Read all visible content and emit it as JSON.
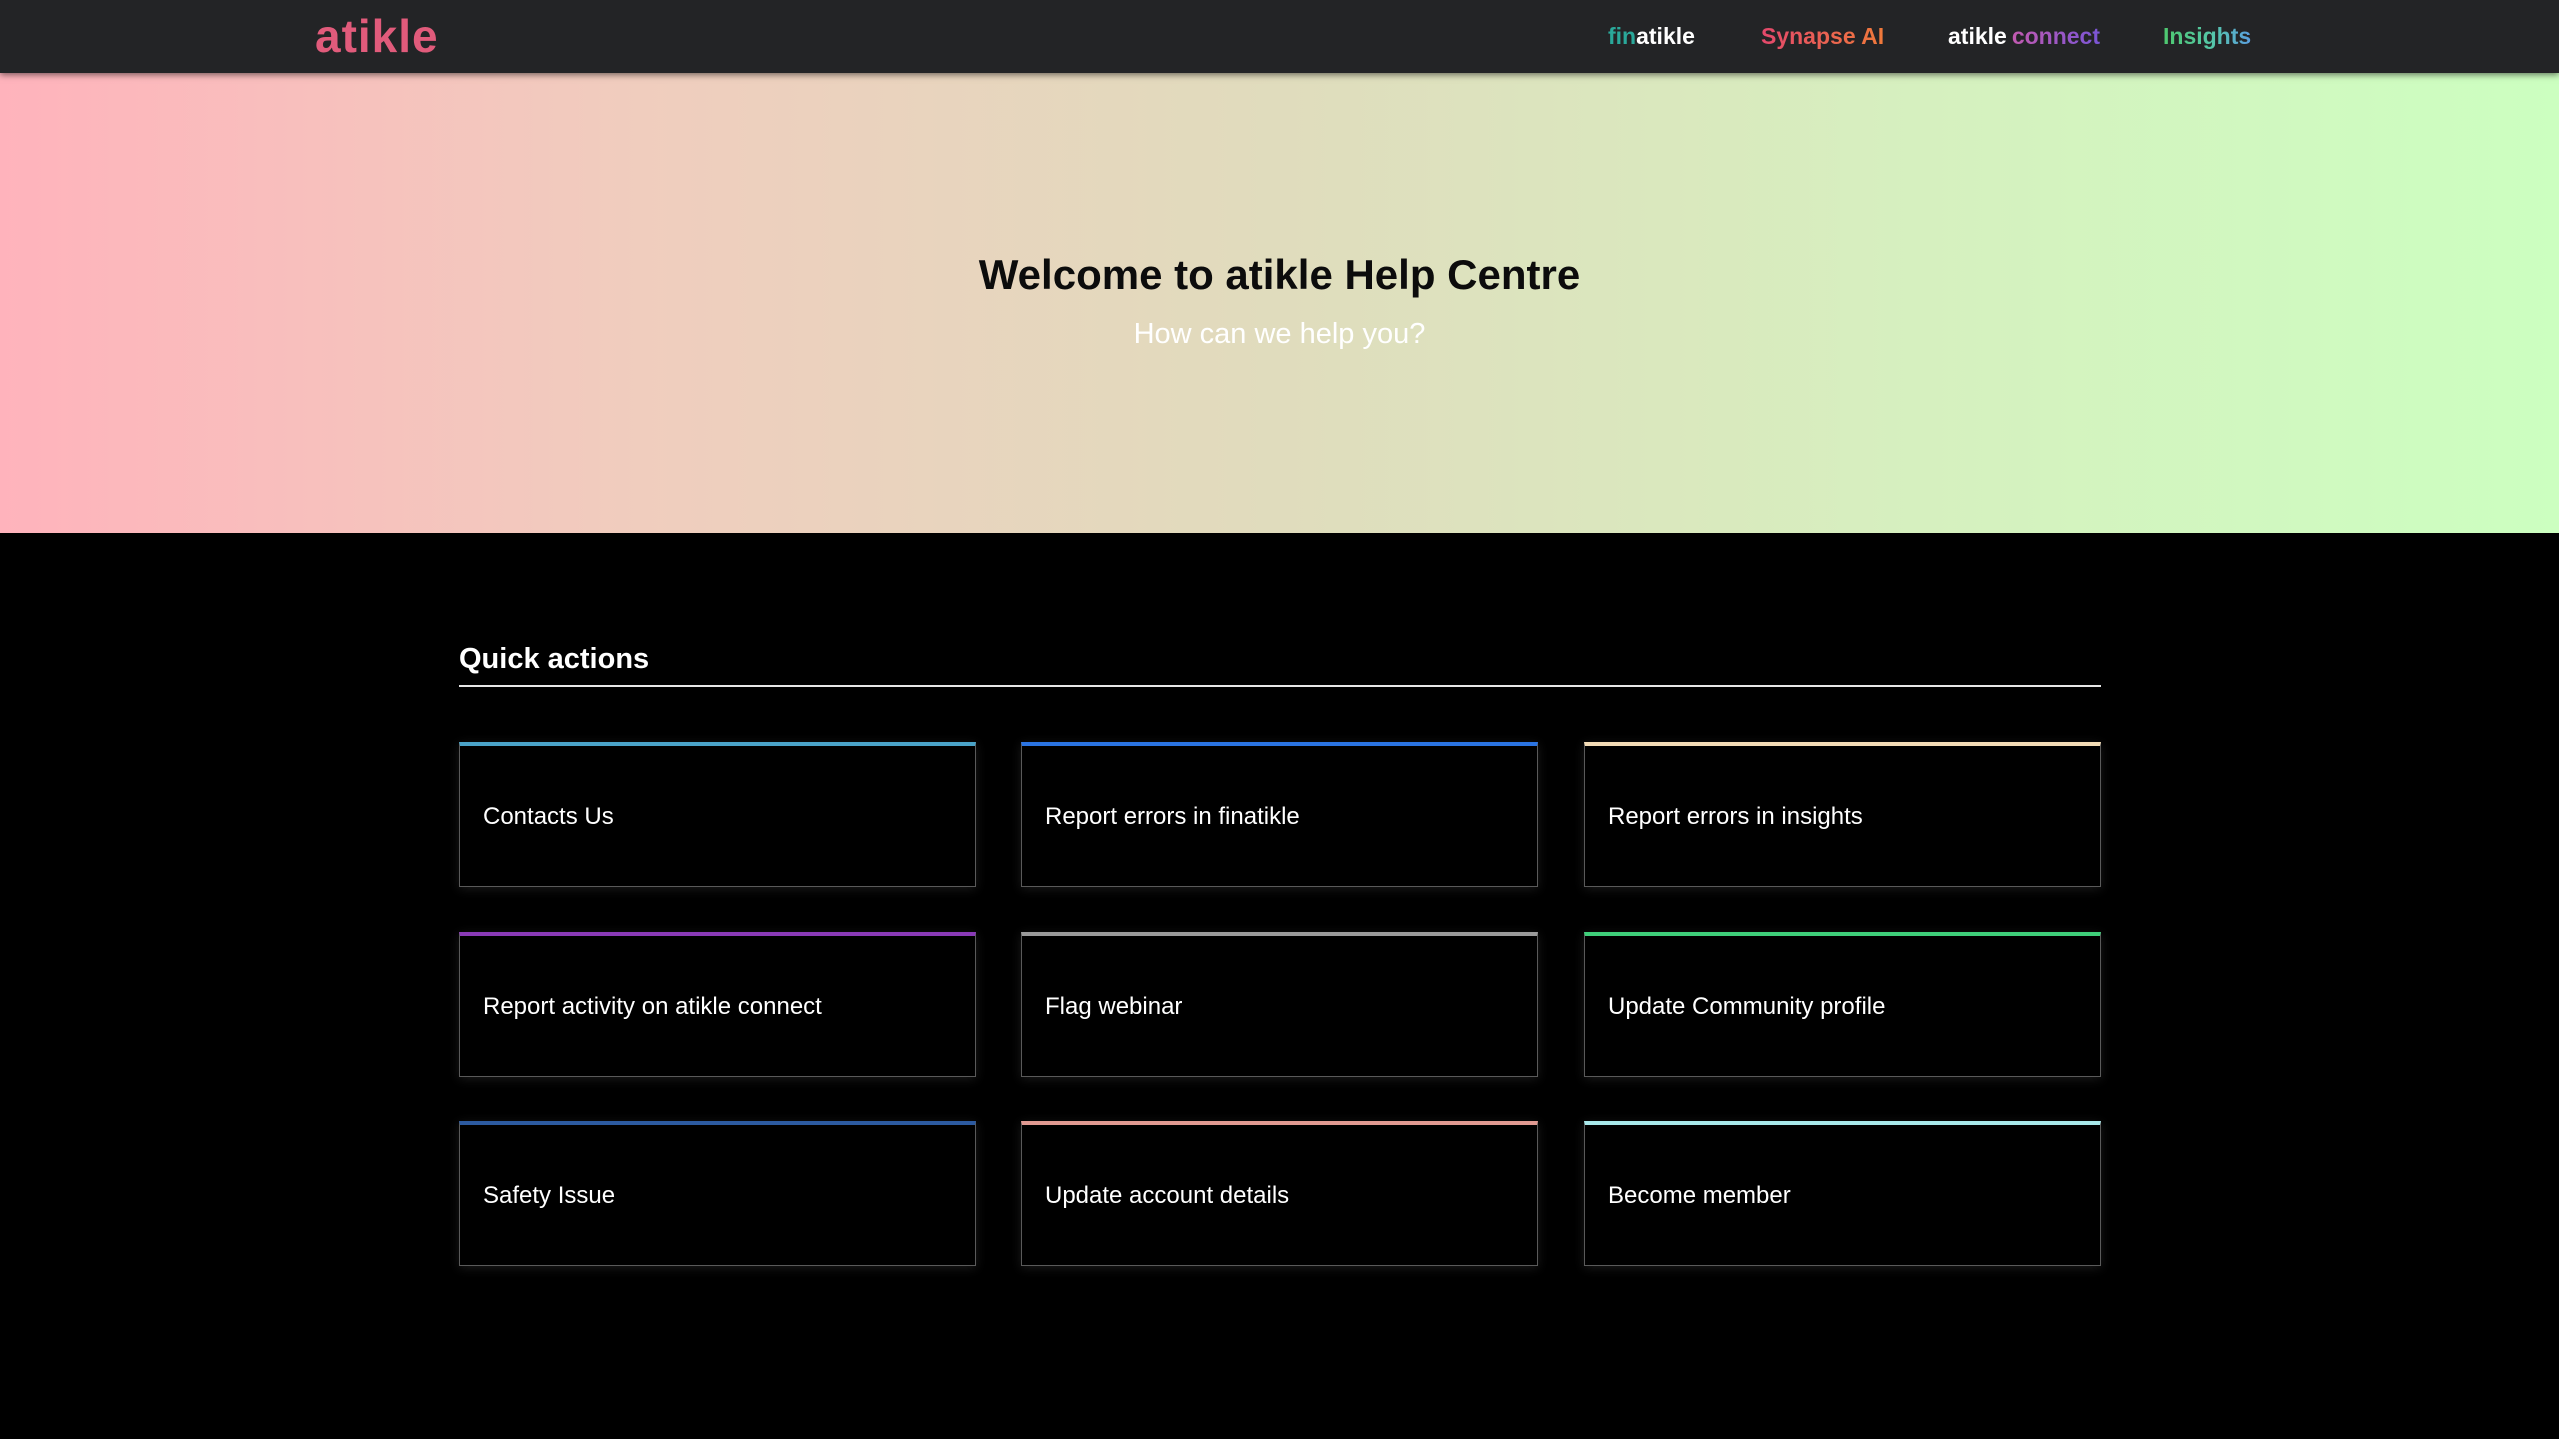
{
  "brand": {
    "logo": "atikle",
    "logo_color": "#e15b7b"
  },
  "nav": {
    "finatikle": {
      "part1": "fin",
      "part2": "atikle"
    },
    "synapse": "Synapse AI",
    "connect": {
      "part1": "atikle",
      "part2": "connect"
    },
    "insights": "Insights"
  },
  "hero": {
    "title": "Welcome to atikle Help Centre",
    "subtitle": "How can we help you?"
  },
  "quick_actions": {
    "title": "Quick actions",
    "cards": [
      {
        "label": "Contacts Us",
        "accent": "#4aa3c8"
      },
      {
        "label": "Report errors in finatikle",
        "accent": "#2b74e2"
      },
      {
        "label": "Report errors in insights",
        "accent": "#f3dcb6"
      },
      {
        "label": "Report activity on atikle connect",
        "accent": "#8a3ab7"
      },
      {
        "label": "Flag webinar",
        "accent": "#9a9a9a"
      },
      {
        "label": "Update Community profile",
        "accent": "#3fcf7a"
      },
      {
        "label": "Safety Issue",
        "accent": "#2c5aa0"
      },
      {
        "label": "Update account details",
        "accent": "#e19a92"
      },
      {
        "label": "Become member",
        "accent": "#a8e8ea"
      }
    ]
  }
}
